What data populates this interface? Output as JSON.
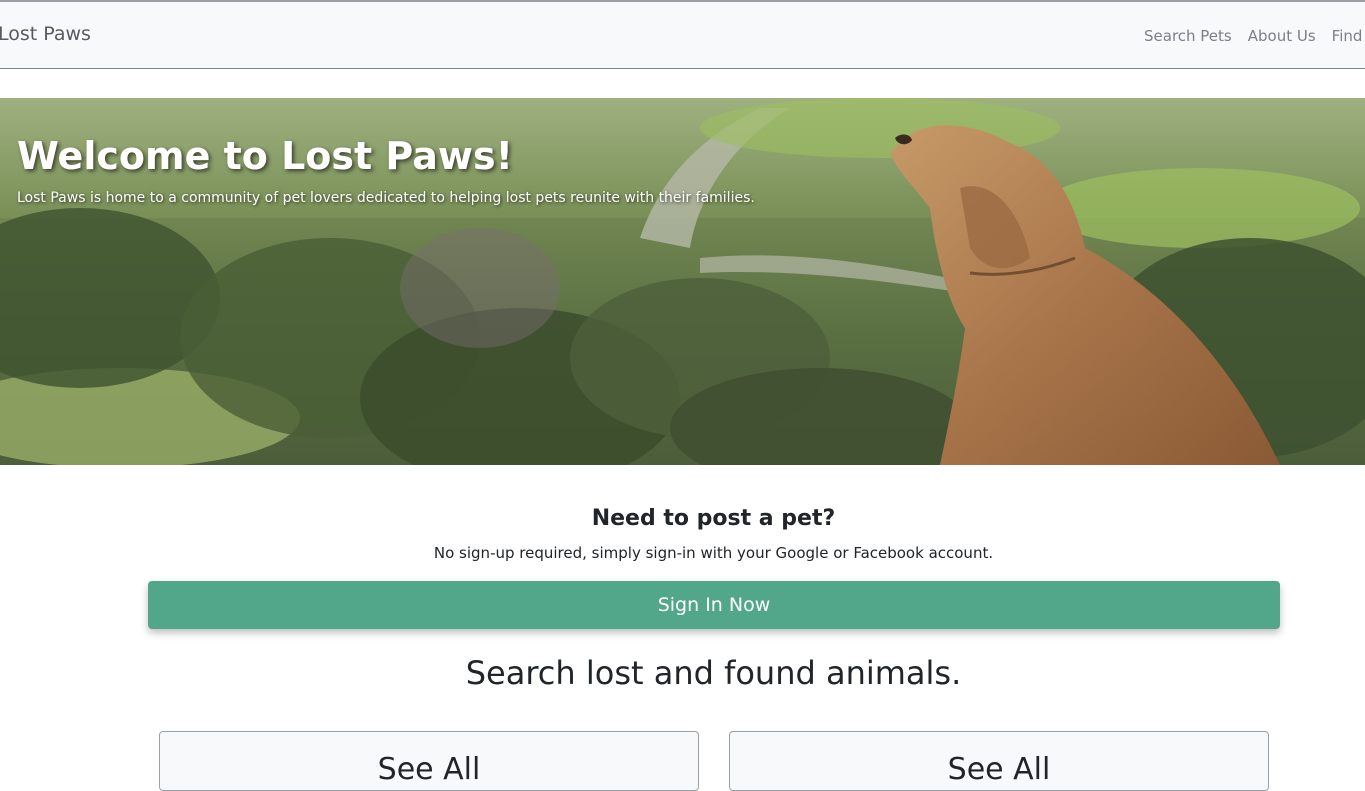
{
  "navbar": {
    "brand": "Lost Paws",
    "links": [
      {
        "label": "Search Pets"
      },
      {
        "label": "About Us"
      },
      {
        "label": "Find a"
      }
    ]
  },
  "hero": {
    "title": "Welcome to Lost Paws!",
    "subtitle": "Lost Paws is home to a community of pet lovers dedicated to helping lost pets reunite with their families."
  },
  "post": {
    "title": "Need to post a pet?",
    "subtitle": "No sign-up required, simply sign-in with your Google or Facebook account.",
    "button_label": "Sign In Now"
  },
  "search": {
    "title": "Search lost and found animals."
  },
  "cards": [
    {
      "link_label": "See All"
    },
    {
      "link_label": "See All"
    }
  ],
  "colors": {
    "accent": "#52a78a",
    "navbar_bg": "#f8f9fa"
  }
}
